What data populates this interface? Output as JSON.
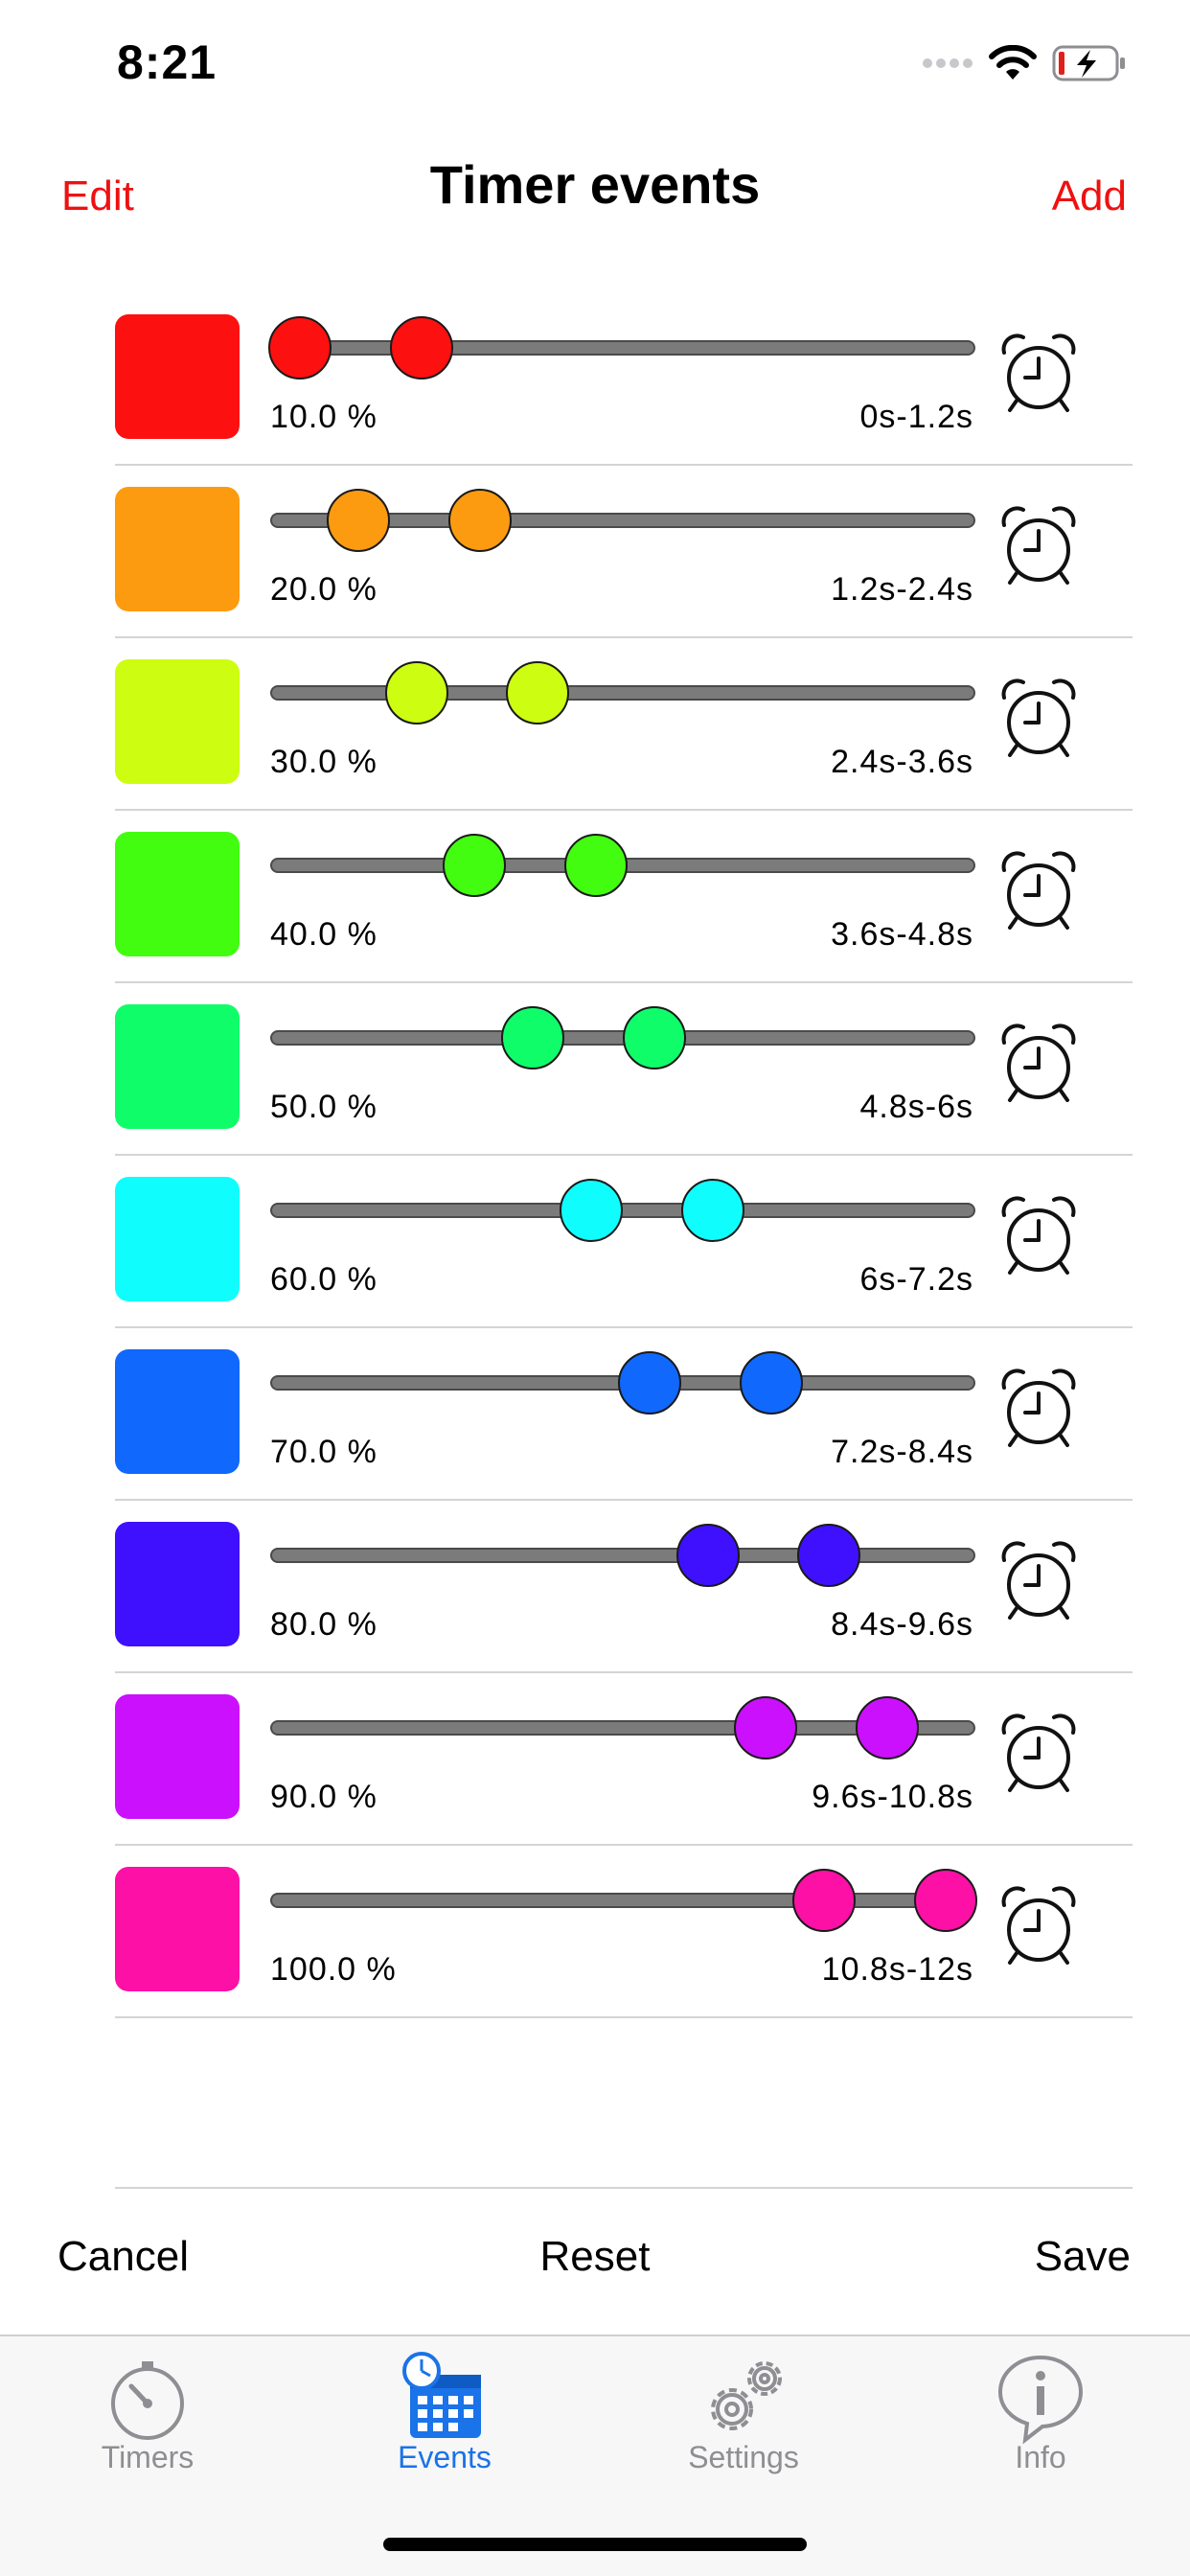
{
  "status_bar": {
    "time": "8:21",
    "icons": [
      "signal-dots-icon",
      "wifi-icon",
      "battery-charging-icon"
    ]
  },
  "nav": {
    "edit_label": "Edit",
    "title": "Timer events",
    "add_label": "Add"
  },
  "events": [
    {
      "color": "#fd1010",
      "percent_label": "10.0 %",
      "range_label": "0s-1.2s",
      "range_start": 0.0,
      "range_end": 0.1
    },
    {
      "color": "#fd9b10",
      "percent_label": "20.0 %",
      "range_label": "1.2s-2.4s",
      "range_start": 0.1,
      "range_end": 0.2
    },
    {
      "color": "#cdfd10",
      "percent_label": "30.0 %",
      "range_label": "2.4s-3.6s",
      "range_start": 0.2,
      "range_end": 0.3
    },
    {
      "color": "#42fd10",
      "percent_label": "40.0 %",
      "range_label": "3.6s-4.8s",
      "range_start": 0.3,
      "range_end": 0.4
    },
    {
      "color": "#10fd6a",
      "percent_label": "50.0 %",
      "range_label": "4.8s-6s",
      "range_start": 0.4,
      "range_end": 0.5
    },
    {
      "color": "#10fdfd",
      "percent_label": "60.0 %",
      "range_label": "6s-7.2s",
      "range_start": 0.5,
      "range_end": 0.6
    },
    {
      "color": "#1068fd",
      "percent_label": "70.0 %",
      "range_label": "7.2s-8.4s",
      "range_start": 0.6,
      "range_end": 0.7
    },
    {
      "color": "#3f10fd",
      "percent_label": "80.0 %",
      "range_label": "8.4s-9.6s",
      "range_start": 0.7,
      "range_end": 0.8
    },
    {
      "color": "#cb10fd",
      "percent_label": "90.0 %",
      "range_label": "9.6s-10.8s",
      "range_start": 0.8,
      "range_end": 0.9
    },
    {
      "color": "#fd10a6",
      "percent_label": "100.0 %",
      "range_label": "10.8s-12s",
      "range_start": 0.9,
      "range_end": 1.0
    }
  ],
  "actions": {
    "cancel_label": "Cancel",
    "reset_label": "Reset",
    "save_label": "Save"
  },
  "tabs": [
    {
      "label": "Timers",
      "icon": "stopwatch-icon",
      "active": false
    },
    {
      "label": "Events",
      "icon": "calendar-clock-icon",
      "active": true
    },
    {
      "label": "Settings",
      "icon": "gears-icon",
      "active": false
    },
    {
      "label": "Info",
      "icon": "info-bubble-icon",
      "active": false
    }
  ],
  "colors": {
    "accent": "#ee1111",
    "tab_active": "#1a73e8",
    "tab_inactive": "#8e8e93"
  }
}
